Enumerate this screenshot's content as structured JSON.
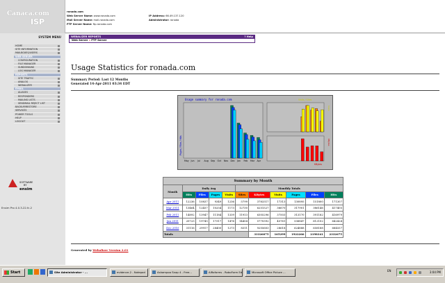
{
  "logo": {
    "line1": "Canaca.com",
    "line2": "ISP"
  },
  "header": {
    "domain": "ronada.com",
    "web_server": "www.ronada.com",
    "mail_server": "mail.ronada.com",
    "ftp_server": "ftp.ronada.com",
    "ip_address": "66.49.137.120",
    "administrator": "ronada",
    "labels": {
      "web": "Web Server Name:",
      "mail": "Mail Server Name:",
      "ftp": "FTP Server Name:",
      "ip": "IP Address:",
      "admin": "Administrator:"
    }
  },
  "sidebar": {
    "title": "SYSTEM MENU",
    "items": [
      {
        "label": "HOME",
        "type": "item"
      },
      {
        "label": "SITE INFORMATION",
        "type": "item"
      },
      {
        "label": "MAILBOXES/USERS",
        "type": "item"
      },
      {
        "label": "WEB SERVER",
        "type": "hdr"
      },
      {
        "label": "CONFIGURATION",
        "type": "sub"
      },
      {
        "label": "FILE MANAGER",
        "type": "sub"
      },
      {
        "label": "SUBDOMAINS",
        "type": "sub"
      },
      {
        "label": "LOG MANAGER",
        "type": "sub"
      },
      {
        "label": "REPORTS",
        "type": "hdr"
      },
      {
        "label": "SITE TRAFFIC",
        "type": "sub"
      },
      {
        "label": "ANALOG",
        "type": "sub"
      },
      {
        "label": "WEBALIZER",
        "type": "sub"
      },
      {
        "label": "EMAIL",
        "type": "hdr"
      },
      {
        "label": "ALIASES",
        "type": "sub"
      },
      {
        "label": "RESPONDERS",
        "type": "sub"
      },
      {
        "label": "MAILING LISTS",
        "type": "sub"
      },
      {
        "label": "SENDMAIL REJECT LIST",
        "type": "sub"
      },
      {
        "label": "BACKUP/RESTORE",
        "type": "item"
      },
      {
        "label": "SERVICES",
        "type": "item"
      },
      {
        "label": "POWER TOOLS",
        "type": "item"
      },
      {
        "label": "HELP",
        "type": "item"
      },
      {
        "label": "LOGOUT",
        "type": "item"
      }
    ],
    "ensim_badge": {
      "top": "SOFTWARE",
      "mid": "BY",
      "name": "ensim"
    },
    "version": "Ensim Pro 4.0.3-22.fc.2"
  },
  "webalizer_bar": {
    "title": "WEBALIZER REPORTS",
    "help": "? Help",
    "crumb_1": "Web Server",
    "crumb_sep": " » ",
    "crumb_2": "FTP Server"
  },
  "page": {
    "title": "Usage Statistics for ronada.com",
    "summary_period": "Summary Period: Last 12 Months",
    "generated": "Generated 14-Apr-2011 03:34 EDT",
    "generated_by_prefix": "Generated by ",
    "generated_by_link": "Webalizer Version 2.01"
  },
  "chart_data": {
    "type": "bar",
    "title": "Usage summary for ronada.com",
    "categories": [
      "May",
      "Jun",
      "Jul",
      "Aug",
      "Sep",
      "Oct",
      "Nov",
      "Dec",
      "Jan",
      "Feb",
      "Mar",
      "Apr"
    ],
    "y_left_label": "Pages / Files / Hits",
    "series": [
      {
        "name": "Hits",
        "values": [
          0,
          0,
          0,
          0,
          0,
          0,
          0,
          31116,
          20723,
          14892,
          13464,
          12236
        ]
      },
      {
        "name": "Files",
        "values": [
          0,
          0,
          0,
          0,
          0,
          0,
          0,
          29917,
          19745,
          13947,
          12457,
          10837
        ]
      },
      {
        "name": "Pages",
        "values": [
          0,
          0,
          0,
          0,
          0,
          0,
          0,
          28400,
          17317,
          11184,
          10254,
          9349
        ]
      }
    ],
    "visits": {
      "name": "Visits / Sites",
      "values": [
        0,
        0,
        0,
        0,
        0,
        0,
        0,
        1273,
        1476,
        1339,
        1173,
        1236
      ]
    },
    "sites": {
      "values": [
        0,
        0,
        0,
        0,
        0,
        0,
        0,
        8311,
        14454,
        11913,
        12730,
        5799
      ]
    },
    "kbytes": {
      "name": "KBytes",
      "values": [
        0,
        0,
        0,
        0,
        0,
        0,
        0,
        9205603,
        5770392,
        6305296,
        6251527,
        3783317
      ]
    },
    "right_top_title": "Visits / Sites",
    "right_bottom_label": "KBytes",
    "right_axis_top": "Visits",
    "right_axis_bottom": "KBytes"
  },
  "table": {
    "caption": "Summary by Month",
    "group_daily": "Daily Avg",
    "group_monthly": "Monthly Totals",
    "col_month": "Month",
    "cols": [
      "Hits",
      "Files",
      "Pages",
      "Visits",
      "Sites",
      "KBytes",
      "Visits",
      "Pages",
      "Files",
      "Hits"
    ],
    "col_colors": [
      "#00805c",
      "#0040ff",
      "#00e0ff",
      "#ffff00",
      "#ff8000",
      "#ff0000",
      "#ffff00",
      "#00e0ff",
      "#0040ff",
      "#00805c"
    ],
    "rows": [
      {
        "month": "Apr 2011",
        "vals": [
          "12236",
          "10837",
          "9349",
          "1236",
          "5799",
          "3783317",
          "17313",
          "130895",
          "151800",
          "171307"
        ]
      },
      {
        "month": "Mar 2011",
        "vals": [
          "13464",
          "12457",
          "10254",
          "1173",
          "12730",
          "6251527",
          "36670",
          "317901",
          "386146",
          "417405"
        ]
      },
      {
        "month": "Feb 2011",
        "vals": [
          "14892",
          "13947",
          "11184",
          "1339",
          "11913",
          "6305296",
          "37503",
          "313170",
          "391182",
          "416979"
        ]
      },
      {
        "month": "Jan 2011",
        "vals": [
          "20723",
          "19745",
          "17317",
          "1476",
          "14454",
          "5770392",
          "45761",
          "536847",
          "612102",
          "642424"
        ]
      },
      {
        "month": "Dec 2010",
        "vals": [
          "31116",
          "29917",
          "28400",
          "1273",
          "8311",
          "9205603",
          "28618",
          "624888",
          "658188",
          "684557"
        ]
      }
    ],
    "totals_label": "Totals",
    "totals": [
      "33326075",
      "165299",
      "1922266",
      "2198341",
      "2332675"
    ]
  },
  "taskbar": {
    "start": "Start",
    "tasks": [
      {
        "label": "Site Administrator - ...",
        "active": true
      },
      {
        "label": "evidence-2 - Notepad",
        "active": false
      },
      {
        "label": "Ashampoo Snap 4 - Free...",
        "active": false
      },
      {
        "label": "AiRoforms - RoboForm Editor",
        "active": false
      },
      {
        "label": "Microsoft Office Picture ...",
        "active": false
      }
    ],
    "lang": "EN",
    "clock": "3:04 PM"
  }
}
